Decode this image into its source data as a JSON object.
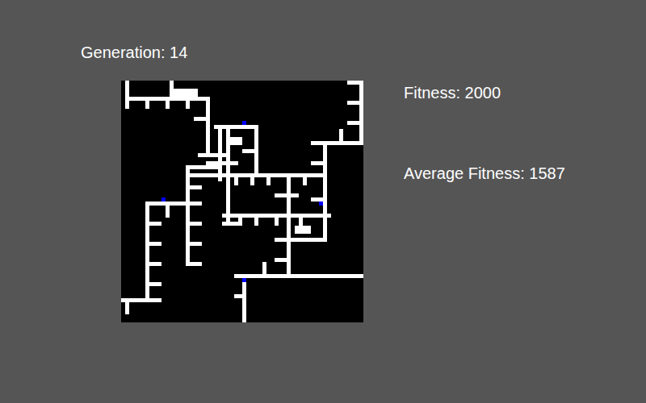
{
  "generation_label": "Generation: 14",
  "fitness_label": "Fitness: 2000",
  "average_fitness_label": "Average Fitness: 1587",
  "maze": {
    "grid_size": 60,
    "paths": [
      [
        1,
        0,
        1,
        6
      ],
      [
        1,
        4,
        21,
        4
      ],
      [
        6,
        4,
        6,
        6
      ],
      [
        11,
        4,
        11,
        6
      ],
      [
        16,
        4,
        16,
        6
      ],
      [
        12,
        0,
        12,
        4
      ],
      [
        13,
        2,
        18,
        3
      ],
      [
        21,
        4,
        21,
        17
      ],
      [
        18,
        9,
        21,
        9
      ],
      [
        59,
        0,
        59,
        15
      ],
      [
        56,
        0,
        59,
        0
      ],
      [
        56,
        5,
        59,
        5
      ],
      [
        56,
        10,
        59,
        10
      ],
      [
        47,
        15,
        59,
        15
      ],
      [
        54,
        12,
        54,
        15
      ],
      [
        50,
        15,
        50,
        39
      ],
      [
        47,
        20,
        50,
        20
      ],
      [
        47,
        29,
        50,
        29
      ],
      [
        16,
        23,
        50,
        23
      ],
      [
        25,
        33,
        51,
        33
      ],
      [
        26,
        12,
        26,
        35
      ],
      [
        41,
        23,
        41,
        48
      ],
      [
        28,
        48,
        41,
        48
      ],
      [
        30,
        48,
        59,
        48
      ],
      [
        30,
        48,
        30,
        59
      ],
      [
        28,
        53,
        30,
        53
      ],
      [
        38,
        39,
        50,
        39
      ],
      [
        50,
        33,
        50,
        39
      ],
      [
        23,
        11,
        33,
        11
      ],
      [
        33,
        11,
        33,
        23
      ],
      [
        24,
        11,
        24,
        24
      ],
      [
        16,
        21,
        16,
        45
      ],
      [
        16,
        21,
        23,
        21
      ],
      [
        16,
        26,
        19,
        26
      ],
      [
        16,
        30,
        19,
        30
      ],
      [
        16,
        35,
        19,
        35
      ],
      [
        16,
        40,
        19,
        40
      ],
      [
        16,
        45,
        19,
        45
      ],
      [
        6,
        30,
        16,
        30
      ],
      [
        6,
        30,
        6,
        54
      ],
      [
        6,
        35,
        9,
        35
      ],
      [
        6,
        40,
        9,
        40
      ],
      [
        6,
        45,
        9,
        45
      ],
      [
        6,
        50,
        9,
        50
      ],
      [
        0,
        54,
        9,
        54
      ],
      [
        1,
        54,
        1,
        57
      ],
      [
        11,
        30,
        11,
        33
      ],
      [
        35,
        45,
        35,
        48
      ],
      [
        38,
        44,
        41,
        44
      ],
      [
        28,
        23,
        28,
        25
      ],
      [
        32,
        23,
        32,
        25
      ],
      [
        36,
        23,
        36,
        25
      ],
      [
        45,
        23,
        45,
        25
      ],
      [
        29,
        33,
        29,
        35
      ],
      [
        33,
        33,
        33,
        35
      ],
      [
        38,
        33,
        38,
        35
      ],
      [
        44,
        33,
        44,
        35
      ],
      [
        38,
        28,
        43,
        28
      ],
      [
        19,
        18,
        26,
        18
      ],
      [
        21,
        20,
        28,
        20
      ],
      [
        30,
        17,
        33,
        17
      ],
      [
        25,
        35,
        28,
        35
      ],
      [
        27,
        14,
        29,
        15
      ],
      [
        43,
        36,
        46,
        37
      ]
    ],
    "agents": [
      {
        "x": 30,
        "y": 10,
        "color": "#0000ff"
      },
      {
        "x": 10,
        "y": 29,
        "color": "#0000ff"
      },
      {
        "x": 49,
        "y": 30,
        "color": "#0000ff"
      },
      {
        "x": 30,
        "y": 49,
        "color": "#0000ff"
      }
    ]
  }
}
